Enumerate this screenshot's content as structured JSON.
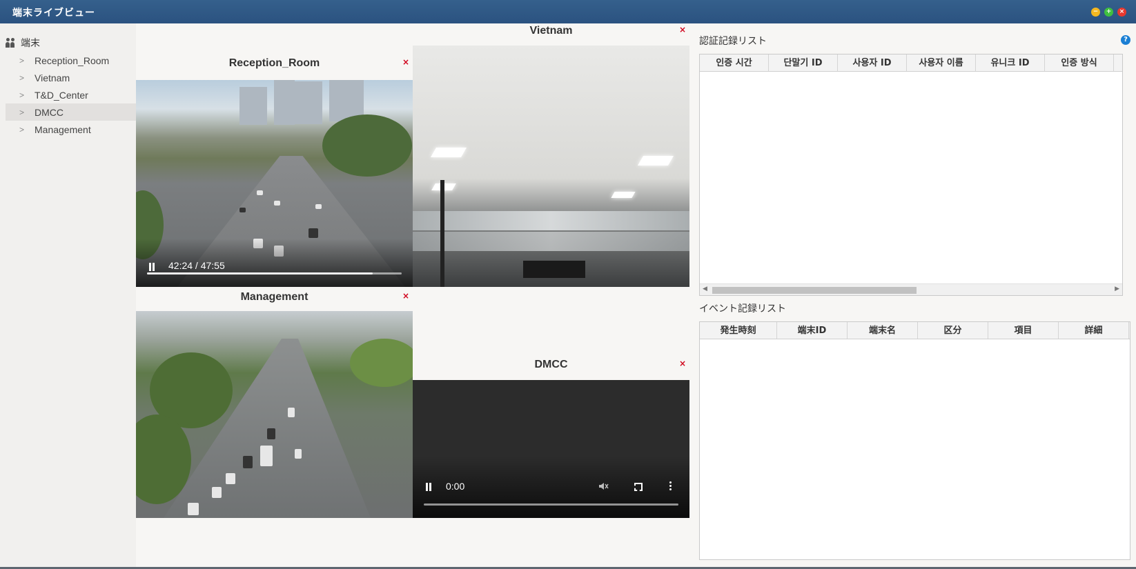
{
  "window": {
    "title": "端末ライブビュー"
  },
  "sidebar": {
    "root_label": "端末",
    "items": [
      {
        "label": "Reception_Room"
      },
      {
        "label": "Vietnam"
      },
      {
        "label": "T&D_Center"
      },
      {
        "label": "DMCC",
        "selected": true
      },
      {
        "label": "Management"
      }
    ]
  },
  "cameras": {
    "close_symbol": "×",
    "reception_room": {
      "title": "Reception_Room",
      "time": "42:24 / 47:55",
      "progress": 0.885
    },
    "vietnam": {
      "title": "Vietnam"
    },
    "management": {
      "title": "Management"
    },
    "dmcc": {
      "title": "DMCC",
      "time": "0:00",
      "progress": 0.0
    }
  },
  "auth_log": {
    "title": "認証記録リスト",
    "columns": [
      "인증 시간",
      "단말기 ID",
      "사용자 ID",
      "사용자 이름",
      "유니크 ID",
      "인증 방식"
    ],
    "rows": []
  },
  "event_log": {
    "title": "イベント記録リスト",
    "columns": [
      "発生時刻",
      "端末ID",
      "端末名",
      "区分",
      "項目",
      "詳細"
    ],
    "rows": []
  },
  "colors": {
    "titlebar": "#2f5886",
    "close_x": "#d0021b",
    "help": "#1a7fd4"
  },
  "icons": {
    "root": "users-icon",
    "tree_chevron": "chevron-right-icon",
    "help": "help-icon",
    "play": "pause-icon",
    "mute": "mute-icon",
    "fullscreen": "fullscreen-icon",
    "more": "more-vertical-icon"
  }
}
